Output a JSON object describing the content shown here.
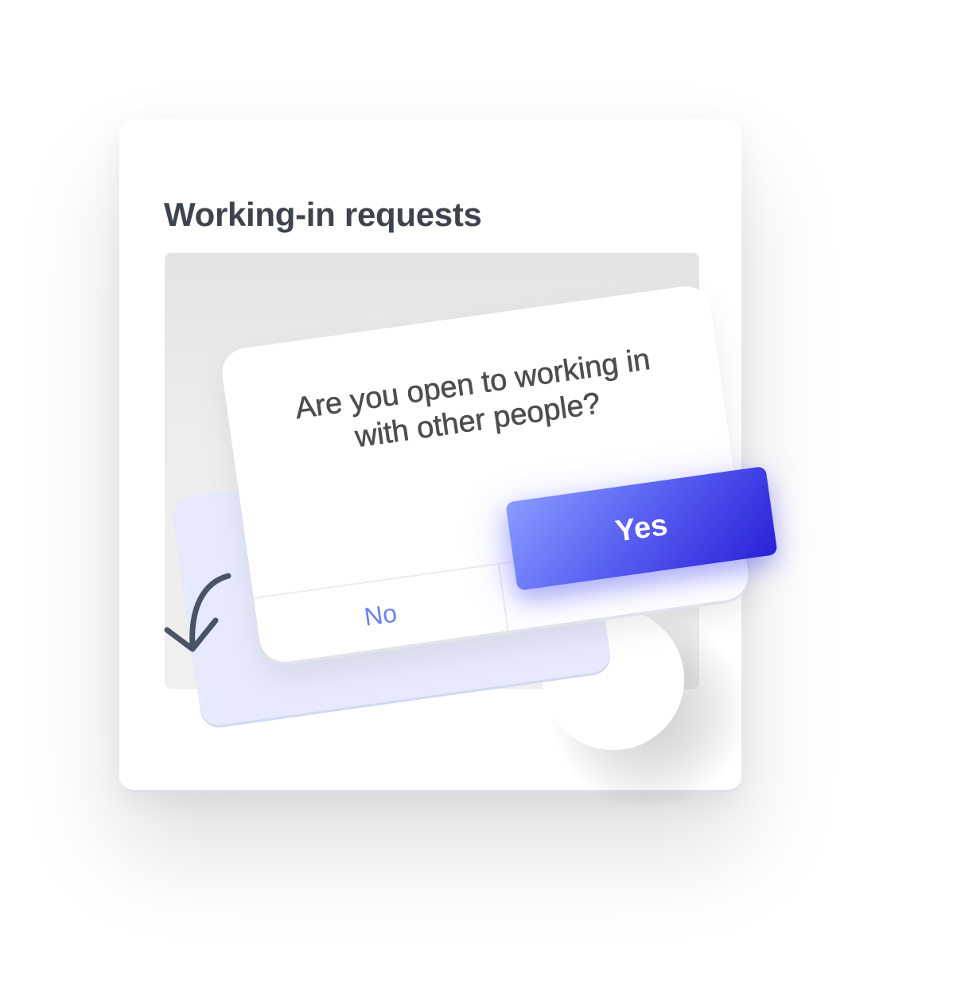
{
  "panel": {
    "title": "Working-in requests"
  },
  "dialog": {
    "question": "Are you open to working in with other people?",
    "no_label": "No",
    "yes_label": "Yes"
  },
  "decorations": {
    "arrow_icon": "curved-arrow-down-left-icon",
    "accent_color": "#5b63f2",
    "no_color": "#6a7ff0",
    "card_color": "#e7eafc"
  }
}
